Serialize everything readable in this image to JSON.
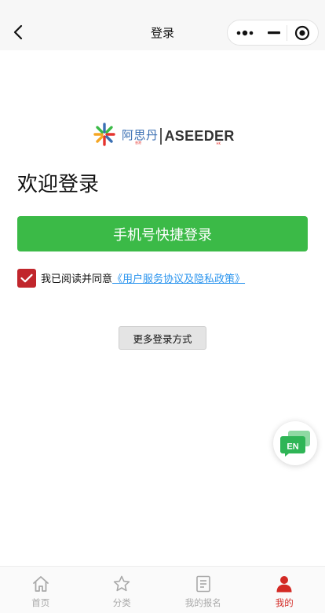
{
  "navbar": {
    "title": "登录",
    "back_icon": "chevron-left-icon",
    "capsule": {
      "more_icon": "more-dots-icon",
      "minimize_icon": "minimize-icon",
      "close_icon": "target-icon"
    }
  },
  "logo": {
    "cn": "阿思丹",
    "cn_sub": "香港",
    "en": "ASEEDER",
    "en_sub": "HK",
    "colors": {
      "blue": "#3a6fb3",
      "red": "#e5342e",
      "orange": "#f5a623",
      "green": "#3bba47"
    }
  },
  "welcome": "欢迎登录",
  "phone_login_label": "手机号快捷登录",
  "agreement": {
    "checked": true,
    "text": "我已阅读并同意",
    "link": "《用户服务协议及隐私政策》"
  },
  "more_ways_label": "更多登录方式",
  "float_button": {
    "label": "EN",
    "icon": "chat-bubble-icon"
  },
  "tabbar": {
    "items": [
      {
        "label": "首页",
        "icon": "home-icon",
        "active": false
      },
      {
        "label": "分类",
        "icon": "star-icon",
        "active": false
      },
      {
        "label": "我的报名",
        "icon": "document-icon",
        "active": false
      },
      {
        "label": "我的",
        "icon": "person-icon",
        "active": true
      }
    ]
  },
  "colors": {
    "primary_green": "#3bba47",
    "checkbox_red": "#c1262c",
    "link_blue": "#2a94ee",
    "tab_active": "#d32a25",
    "tab_inactive": "#a9a9a9"
  }
}
